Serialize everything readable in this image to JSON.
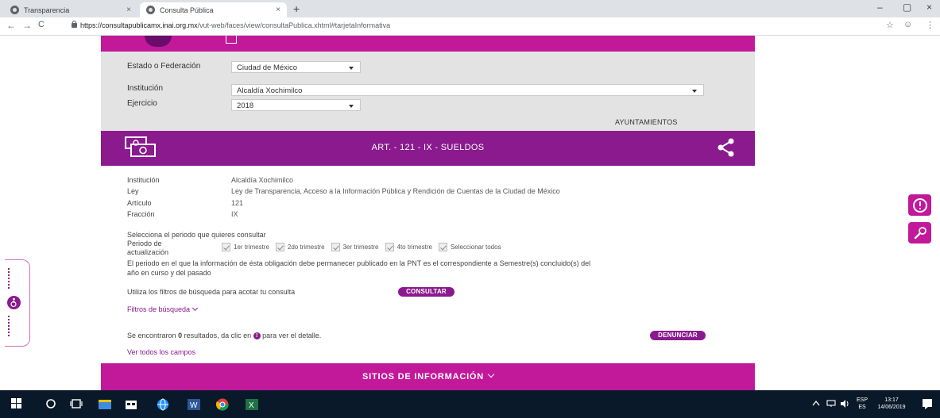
{
  "browser": {
    "tabs": [
      {
        "title": "Transparencia",
        "active": false
      },
      {
        "title": "Consulta Pública",
        "active": true
      }
    ],
    "new_tab": "+",
    "close_glyph": "×",
    "window_controls": {
      "minimize": "–",
      "maximize": "▢",
      "close": "×"
    },
    "nav": {
      "back": "←",
      "forward": "→",
      "reload": "C"
    },
    "url_host": "https://consultapublicamx.inai.org.mx",
    "url_path": "/vut-web/faces/view/consultaPublica.xhtml#tarjetaInformativa",
    "toolbar_icons": {
      "star": "☆",
      "profile": "☺",
      "menu": "⋮"
    }
  },
  "form": {
    "estado_label": "Estado o Federación",
    "estado_value": "Ciudad de México",
    "institucion_label": "Institución",
    "institucion_value": "Alcaldía Xochimilco",
    "ejercicio_label": "Ejercicio",
    "ejercicio_value": "2018",
    "category": "AYUNTAMIENTOS"
  },
  "section": {
    "title": "ART. - 121 - IX - SUELDOS"
  },
  "details": {
    "institucion_label": "Institución",
    "institucion_value": "Alcaldía Xochimilco",
    "ley_label": "Ley",
    "ley_value": "Ley de Transparencia, Acceso a la Información Pública y Rendición de Cuentas de la Ciudad de México",
    "articulo_label": "Artículo",
    "articulo_value": "121",
    "fraccion_label": "Fracción",
    "fraccion_value": "IX"
  },
  "periodo": {
    "prompt": "Selecciona el periodo que quieres consultar",
    "label": "Periodo de actualización",
    "options": [
      "1er trimestre",
      "2do trimestre",
      "3er trimestre",
      "4to trimestre",
      "Seleccionar todos"
    ],
    "note_line1": "El periodo en el que la información de ésta obligación debe permanecer publicado en la PNT es el correspondiente a Semestre(s) concluido(s) del",
    "note_line2": "año en curso y del pasado"
  },
  "search": {
    "hint": "Utiliza los filtros de búsqueda para acotar tu consulta",
    "consultar_label": "CONSULTAR",
    "filtros_label": "Filtros de búsqueda"
  },
  "results": {
    "prefix": "Se encontraron",
    "count": "0",
    "middle": "resultados, da clic en",
    "info_glyph": "!",
    "suffix": "para ver el detalle.",
    "denunciar_label": "DENUNCIAR",
    "ver_todos": "Ver todos los campos"
  },
  "footer": {
    "sitios_label": "SITIOS DE INFORMACIÓN"
  },
  "taskbar": {
    "lang_top": "ESP",
    "lang_bottom": "ES",
    "time": "13:17",
    "date": "14/06/2019"
  },
  "colors": {
    "magenta": "#c2189a",
    "purple": "#8a1a8e",
    "form_gray": "#e3e3e3",
    "taskbar": "#0a1929"
  }
}
